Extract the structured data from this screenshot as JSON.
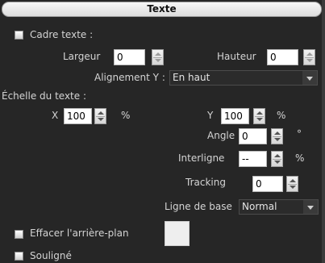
{
  "header": {
    "title": "Texte"
  },
  "cadre": {
    "label": "Cadre texte :",
    "checked": false
  },
  "largeur": {
    "label": "Largeur",
    "value": "0"
  },
  "hauteur": {
    "label": "Hauteur",
    "value": "0"
  },
  "alignement": {
    "label": "Alignement Y :",
    "value": "En haut"
  },
  "echelle": {
    "label": "Échelle du texte :",
    "x_label": "X",
    "x_value": "100",
    "y_label": "Y",
    "y_value": "100",
    "unit": "%"
  },
  "angle": {
    "label": "Angle",
    "value": "0",
    "unit": "°"
  },
  "interligne": {
    "label": "Interligne",
    "value": "--",
    "unit": "%"
  },
  "tracking": {
    "label": "Tracking",
    "value": "0"
  },
  "ligne_base": {
    "label": "Ligne de base",
    "value": "Normal"
  },
  "effacer": {
    "label": "Effacer l'arrière-plan",
    "checked": false,
    "swatch_color": "#eeeeee"
  },
  "souligne": {
    "label": "Souligné",
    "checked": false
  }
}
